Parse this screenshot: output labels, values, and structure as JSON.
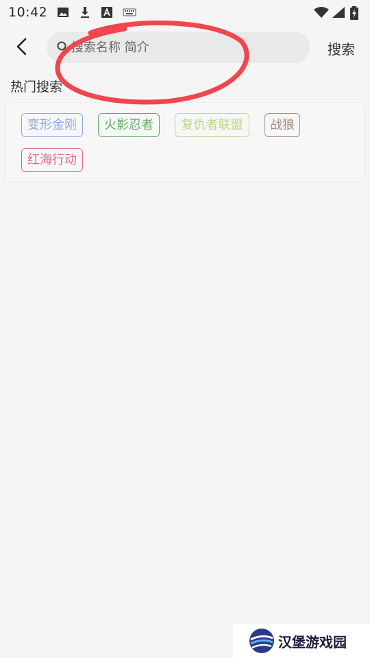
{
  "status_bar": {
    "time": "10:42",
    "left_icons": [
      "image-icon",
      "download-icon",
      "font-icon",
      "keyboard-icon"
    ],
    "right_icons": [
      "wifi-icon",
      "signal-icon",
      "battery-charging-icon"
    ]
  },
  "search": {
    "placeholder": "搜索名称 简介",
    "submit_label": "搜索"
  },
  "hot": {
    "title": "热门搜索",
    "tags": [
      {
        "label": "变形金刚",
        "color": "#8ea6e6"
      },
      {
        "label": "火影忍者",
        "color": "#5fae5f"
      },
      {
        "label": "复仇者联盟",
        "color": "#b9d98a"
      },
      {
        "label": "战狼",
        "color": "#a88a80"
      },
      {
        "label": "红海行动",
        "color": "#e0678f"
      }
    ]
  },
  "annotation": {
    "color": "#f0474f"
  },
  "watermark": {
    "text": "汉堡游戏园"
  }
}
